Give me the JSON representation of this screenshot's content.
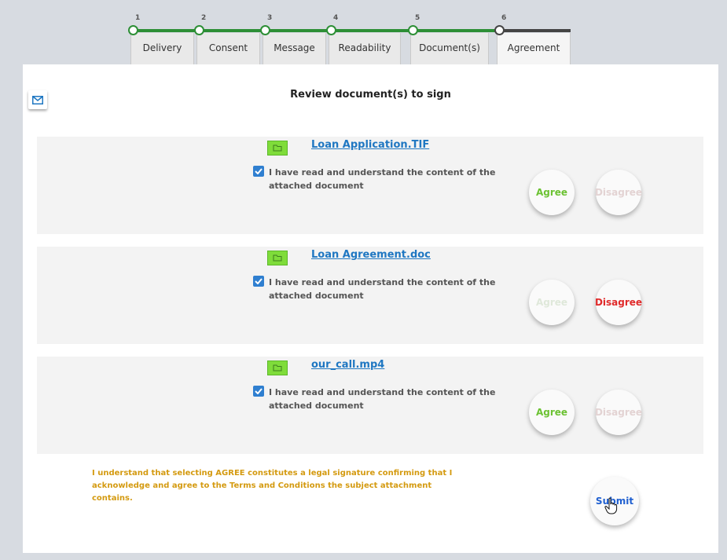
{
  "stepper": {
    "steps": [
      {
        "num": "1",
        "label": "Delivery"
      },
      {
        "num": "2",
        "label": "Consent"
      },
      {
        "num": "3",
        "label": "Message"
      },
      {
        "num": "4",
        "label": "Readability"
      },
      {
        "num": "5",
        "label": "Document(s)"
      },
      {
        "num": "6",
        "label": "Agreement"
      }
    ],
    "completed_color": "#2d8f36",
    "current_color": "#444444"
  },
  "page": {
    "title": "Review document(s) to sign",
    "mail_icon": "mail-icon"
  },
  "documents": [
    {
      "name": "Loan Application.TIF",
      "ack_text": "I have read and understand the content of the attached document",
      "checked": true,
      "agree_label": "Agree",
      "disagree_label": "Disagree",
      "decision": "agree"
    },
    {
      "name": "Loan Agreement.doc",
      "ack_text": "I have read and understand the content of the attached document",
      "checked": true,
      "agree_label": "Agree",
      "disagree_label": "Disagree",
      "decision": "disagree"
    },
    {
      "name": "our_call.mp4",
      "ack_text": "I have read and understand the content of the attached document",
      "checked": true,
      "agree_label": "Agree",
      "disagree_label": "Disagree",
      "decision": "agree"
    }
  ],
  "legal_text": "I understand that selecting AGREE constitutes a legal signature confirming that I acknowledge and agree to the Terms and Conditions the subject attachment contains.",
  "submit_label": "Submit",
  "colors": {
    "agree": "#6cc233",
    "disagree": "#e02a2a",
    "link": "#1f77c2",
    "legal": "#d49a10",
    "folder": "#7fdc3a"
  }
}
